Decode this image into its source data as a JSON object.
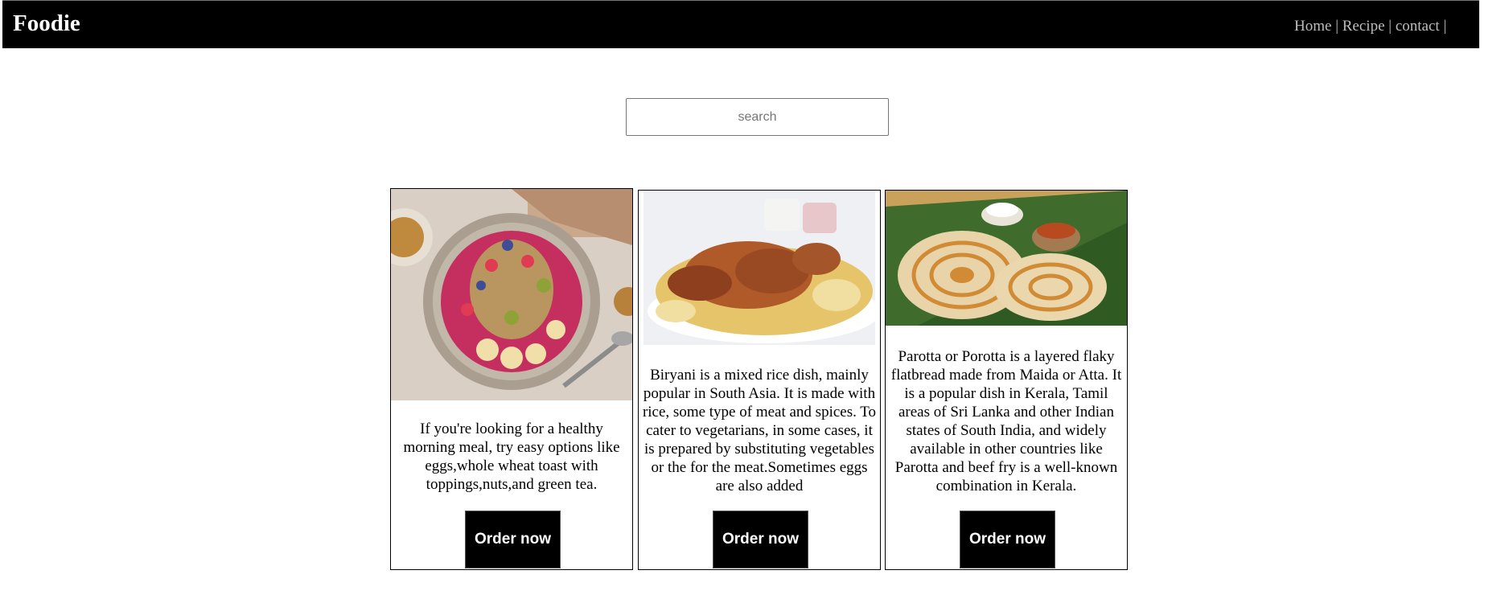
{
  "brand": "Foodie",
  "nav": {
    "items": [
      "Home",
      "Recipe",
      "contact"
    ],
    "separator": " | "
  },
  "search": {
    "placeholder": "search",
    "value": ""
  },
  "cards": [
    {
      "image": "smoothie-bowl-photo",
      "description": "If you're looking for a healthy morning meal, try easy options like eggs,whole wheat toast with toppings,nuts,and green tea.",
      "button": "Order now"
    },
    {
      "image": "biryani-photo",
      "description": "Biryani is a mixed rice dish, mainly popular in South Asia. It is made with rice, some type of meat and spices. To cater to vegetarians, in some cases, it is prepared by substituting vegetables or the for the meat.Sometimes eggs are also added",
      "button": "Order now"
    },
    {
      "image": "parotta-photo",
      "description": "Parotta or Porotta is a layered flaky flatbread made from Maida or Atta. It is a popular dish in Kerala, Tamil areas of Sri Lanka and other Indian states of South India, and widely available in other countries like Parotta and beef fry is a well-known combination in Kerala.",
      "button": "Order now"
    }
  ]
}
